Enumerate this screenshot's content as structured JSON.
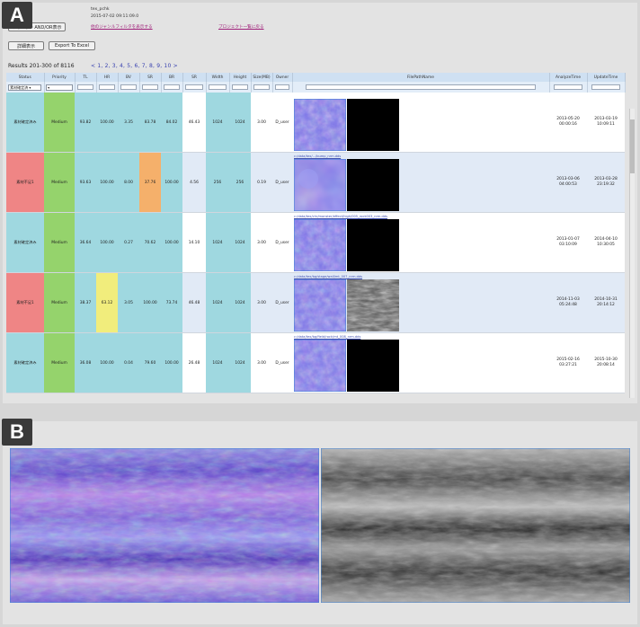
{
  "panel_a": {
    "label": "A",
    "header": {
      "title": "tex_pchk",
      "date": "2015-07-02 09:11:09.0",
      "button1": "フィルタ・AND/OR表示",
      "link1": "他のジャンルフィルタを表示する",
      "link2": "プロジェクト一覧に戻る",
      "detail_button": "詳細表示",
      "export_button": "Export To Excel"
    },
    "results": {
      "text": "Results 201-300 of 8116",
      "pager": "< 1, 2, 3, 4, 5, 6, 7, 8, 9, 10 >"
    },
    "columns": [
      "Status",
      "Priority",
      "TL",
      "HR",
      "BV",
      "SR",
      "BR",
      "SR",
      "Width",
      "Height",
      "Size(MB)",
      "Owner",
      "FilePathName",
      "AnalyzeTime",
      "UpdateTime"
    ],
    "filter": {
      "status_select": "素材確定済 ▾",
      "priority_select": "▾"
    },
    "rows": [
      {
        "status": "素材確定済み",
        "priority": "Medium",
        "v1": "93.82",
        "v2": "100.00",
        "v3": "3.35",
        "v4": "83.78",
        "v5": "84.02",
        "v6": "46.43",
        "w": "1024",
        "h": "1024",
        "mb": "3.00",
        "owner": "D_user",
        "file": "",
        "atime": "2013-05-20\n00:00:16",
        "utime": "2013-03-19\n10:09:11"
      },
      {
        "status": "素材不足1",
        "priority": "Medium",
        "v1": "93.63",
        "v2": "100.00",
        "v3": "8.00",
        "v4": "37.76",
        "v5": "100.00",
        "v6": "4.56",
        "w": "256",
        "h": "256",
        "mb": "0.19",
        "owner": "D_user",
        "file": "c:/data/tex/.../bump_nrm.dds",
        "atime": "2013-03-06\n04:00:53",
        "utime": "2013-03-28\n23:19:32"
      },
      {
        "status": "素材確定済み",
        "priority": "Medium",
        "v1": "36.64",
        "v2": "100.00",
        "v3": "0.27",
        "v4": "70.62",
        "v5": "100.00",
        "v6": "14.10",
        "w": "1024",
        "h": "1024",
        "mb": "3.00",
        "owner": "D_user",
        "file": "c:/data/tex/chr/monster/effect/high/005_rock003_nrm.dds",
        "atime": "2013-01-07\n03:10:09",
        "utime": "2014-04-10\n10:30:05"
      },
      {
        "status": "素材不足1",
        "priority": "Medium",
        "v1": "38.37",
        "v2": "63.12",
        "v3": "3.05",
        "v4": "100.00",
        "v5": "73.74",
        "v6": "46.48",
        "w": "1024",
        "h": "1024",
        "mb": "3.00",
        "owner": "D_user",
        "file": "c:/data/tex/bg/stage/wall/mt_007_nrm.dds",
        "atime": "2014-11-03\n05:24:48",
        "utime": "2014-10-31\n20:14:12"
      },
      {
        "status": "素材確定済み",
        "priority": "Medium",
        "v1": "36.08",
        "v2": "100.00",
        "v3": "0.04",
        "v4": "79.60",
        "v5": "100.00",
        "v6": "26.48",
        "w": "1024",
        "h": "1024",
        "mb": "3.00",
        "owner": "D_user",
        "file": "c:/data/tex/bg/field/rock/mt_008_nrm.dds",
        "atime": "2015-02-16\n03:27:21",
        "utime": "2015-10-30\n20:08:14"
      }
    ]
  },
  "panel_b": {
    "label": "B"
  },
  "colors": {
    "status_ok": "#9fd8e0",
    "status_ng": "#ef8585",
    "priority": "#95d36c",
    "cyan": "#9fd8e0",
    "orange": "#f5b06b",
    "yellow": "#f1ed7c",
    "header": "#cfe0f2",
    "link": "#3a43b0"
  }
}
